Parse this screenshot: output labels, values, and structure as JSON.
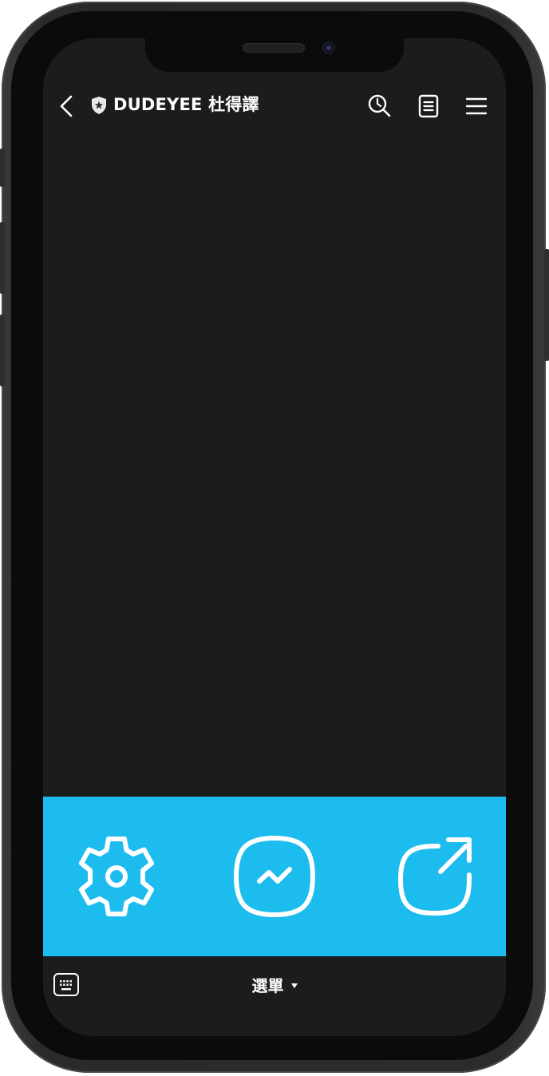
{
  "colors": {
    "screen_background": "#1c1c1d",
    "menu_panel": "#1cbcef",
    "icon_stroke": "#ffffff",
    "header_text": "#ffffff"
  },
  "header": {
    "back_icon": "chevron-left-icon",
    "badge_icon": "shield-star-icon",
    "title": "DUDEYEE 杜得譯",
    "actions": [
      {
        "name": "search",
        "icon": "search-icon"
      },
      {
        "name": "notes",
        "icon": "document-icon"
      },
      {
        "name": "more",
        "icon": "hamburger-menu-icon"
      }
    ]
  },
  "rich_menu": {
    "buttons": [
      {
        "name": "settings",
        "icon": "gear-icon"
      },
      {
        "name": "chat",
        "icon": "messenger-icon"
      },
      {
        "name": "share",
        "icon": "share-arrow-icon"
      }
    ]
  },
  "bottom_bar": {
    "keyboard_icon": "keyboard-icon",
    "menu_label": "選單",
    "menu_caret_icon": "caret-down-icon"
  }
}
